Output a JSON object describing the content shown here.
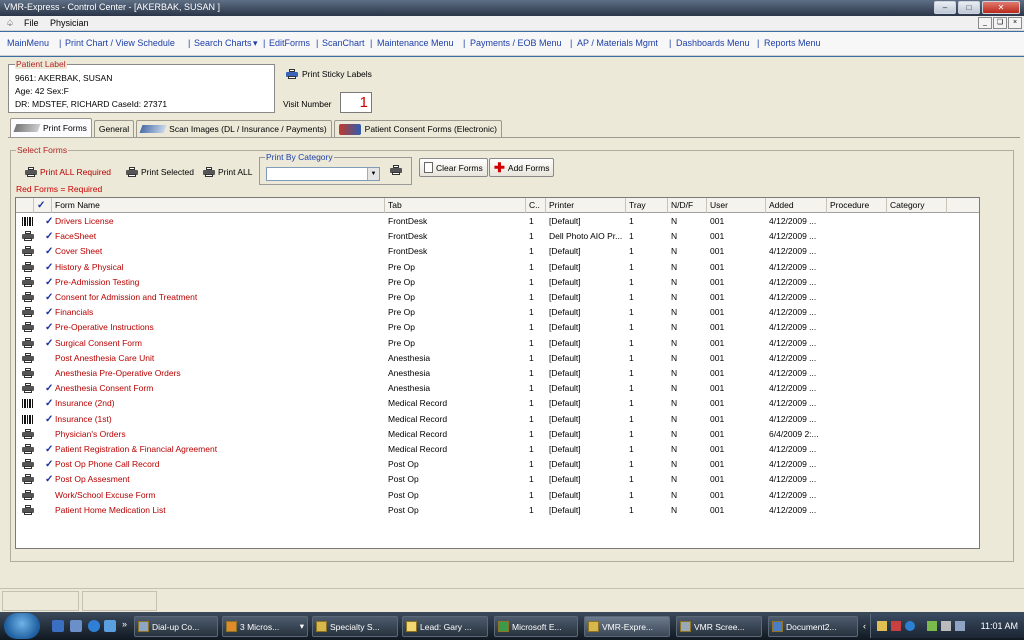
{
  "window": {
    "title": "VMR-Express - Control Center - [AKERBAK, SUSAN     ]"
  },
  "menubar": {
    "file": "File",
    "physician": "Physician"
  },
  "nav": [
    "MainMenu",
    "Print Chart / View Schedule",
    "Search Charts",
    "EditForms",
    "ScanChart",
    "Maintenance Menu",
    "Payments / EOB Menu",
    "AP / Materials Mgmt",
    "Dashboards Menu",
    "Reports Menu"
  ],
  "patient": {
    "legend": "Patient Label",
    "line1": "9661: AKERBAK, SUSAN",
    "line2": "Age: 42    Sex:F",
    "line3": "DR: MDSTEF, RICHARD    CaseId: 27371"
  },
  "sticky_label": "Print Sticky Labels",
  "visit": {
    "label": "Visit Number",
    "value": "1"
  },
  "tabs": [
    "Print Forms",
    "General",
    "Scan Images (DL / Insurance / Payments)",
    "Patient Consent Forms (Electronic)"
  ],
  "select_forms": {
    "legend": "Select Forms",
    "print_all_required": "Print ALL Required",
    "print_selected": "Print Selected",
    "print_all": "Print ALL",
    "category_legend": "Print By Category",
    "category_value": "",
    "clear_forms": "Clear Forms",
    "add_forms": "Add Forms",
    "required_note": "Red Forms = Required"
  },
  "grid": {
    "headers": [
      "",
      "",
      "Form Name",
      "Tab",
      "C..",
      "Printer",
      "Tray",
      "N/D/F",
      "User",
      "Added",
      "Procedure",
      "Category"
    ],
    "rows": [
      {
        "icon": "barcode",
        "checked": true,
        "name": "Drivers License",
        "tab": "FrontDesk",
        "c": "1",
        "printer": "[Default]",
        "tray": "1",
        "ndf": "N",
        "user": "001",
        "added": "4/12/2009 ...",
        "procedure": "",
        "category": ""
      },
      {
        "icon": "printer",
        "checked": true,
        "name": "FaceSheet",
        "tab": "FrontDesk",
        "c": "1",
        "printer": "Dell Photo AIO Pr...",
        "tray": "1",
        "ndf": "N",
        "user": "001",
        "added": "4/12/2009 ...",
        "procedure": "",
        "category": ""
      },
      {
        "icon": "printer",
        "checked": true,
        "name": "Cover Sheet",
        "tab": "FrontDesk",
        "c": "1",
        "printer": "[Default]",
        "tray": "1",
        "ndf": "N",
        "user": "001",
        "added": "4/12/2009 ...",
        "procedure": "",
        "category": ""
      },
      {
        "icon": "printer",
        "checked": true,
        "name": "History & Physical",
        "tab": "Pre Op",
        "c": "1",
        "printer": "[Default]",
        "tray": "1",
        "ndf": "N",
        "user": "001",
        "added": "4/12/2009 ...",
        "procedure": "",
        "category": ""
      },
      {
        "icon": "printer",
        "checked": true,
        "name": "Pre-Admission Testing",
        "tab": "Pre Op",
        "c": "1",
        "printer": "[Default]",
        "tray": "1",
        "ndf": "N",
        "user": "001",
        "added": "4/12/2009 ...",
        "procedure": "",
        "category": ""
      },
      {
        "icon": "printer",
        "checked": true,
        "name": "Consent for Admission and Treatment",
        "tab": "Pre Op",
        "c": "1",
        "printer": "[Default]",
        "tray": "1",
        "ndf": "N",
        "user": "001",
        "added": "4/12/2009 ...",
        "procedure": "",
        "category": ""
      },
      {
        "icon": "printer",
        "checked": true,
        "name": "Financials",
        "tab": "Pre Op",
        "c": "1",
        "printer": "[Default]",
        "tray": "1",
        "ndf": "N",
        "user": "001",
        "added": "4/12/2009 ...",
        "procedure": "",
        "category": ""
      },
      {
        "icon": "printer",
        "checked": true,
        "name": "Pre-Operative Instructions",
        "tab": "Pre Op",
        "c": "1",
        "printer": "[Default]",
        "tray": "1",
        "ndf": "N",
        "user": "001",
        "added": "4/12/2009 ...",
        "procedure": "",
        "category": ""
      },
      {
        "icon": "printer",
        "checked": true,
        "name": "Surgical Consent Form",
        "tab": "Pre Op",
        "c": "1",
        "printer": "[Default]",
        "tray": "1",
        "ndf": "N",
        "user": "001",
        "added": "4/12/2009 ...",
        "procedure": "",
        "category": ""
      },
      {
        "icon": "printer",
        "checked": false,
        "name": "Post Anesthesia Care Unit",
        "tab": "Anesthesia",
        "c": "1",
        "printer": "[Default]",
        "tray": "1",
        "ndf": "N",
        "user": "001",
        "added": "4/12/2009 ...",
        "procedure": "",
        "category": ""
      },
      {
        "icon": "printer",
        "checked": false,
        "name": "Anesthesia Pre-Operative Orders",
        "tab": "Anesthesia",
        "c": "1",
        "printer": "[Default]",
        "tray": "1",
        "ndf": "N",
        "user": "001",
        "added": "4/12/2009 ...",
        "procedure": "",
        "category": ""
      },
      {
        "icon": "printer",
        "checked": true,
        "name": "Anesthesia Consent Form",
        "tab": "Anesthesia",
        "c": "1",
        "printer": "[Default]",
        "tray": "1",
        "ndf": "N",
        "user": "001",
        "added": "4/12/2009 ...",
        "procedure": "",
        "category": ""
      },
      {
        "icon": "barcode",
        "checked": true,
        "name": "Insurance (2nd)",
        "tab": "Medical Record",
        "c": "1",
        "printer": "[Default]",
        "tray": "1",
        "ndf": "N",
        "user": "001",
        "added": "4/12/2009 ...",
        "procedure": "",
        "category": ""
      },
      {
        "icon": "barcode",
        "checked": true,
        "name": "Insurance (1st)",
        "tab": "Medical Record",
        "c": "1",
        "printer": "[Default]",
        "tray": "1",
        "ndf": "N",
        "user": "001",
        "added": "4/12/2009 ...",
        "procedure": "",
        "category": ""
      },
      {
        "icon": "printer",
        "checked": false,
        "name": "Physician's Orders",
        "tab": "Medical Record",
        "c": "1",
        "printer": "[Default]",
        "tray": "1",
        "ndf": "N",
        "user": "001",
        "added": "6/4/2009 2:...",
        "procedure": "",
        "category": ""
      },
      {
        "icon": "printer",
        "checked": true,
        "name": "Patient Registration & Financial Agreement",
        "tab": "Medical Record",
        "c": "1",
        "printer": "[Default]",
        "tray": "1",
        "ndf": "N",
        "user": "001",
        "added": "4/12/2009 ...",
        "procedure": "",
        "category": ""
      },
      {
        "icon": "printer",
        "checked": true,
        "name": "Post Op Phone Call Record",
        "tab": "Post Op",
        "c": "1",
        "printer": "[Default]",
        "tray": "1",
        "ndf": "N",
        "user": "001",
        "added": "4/12/2009 ...",
        "procedure": "",
        "category": ""
      },
      {
        "icon": "printer",
        "checked": true,
        "name": "Post Op Assesment",
        "tab": "Post Op",
        "c": "1",
        "printer": "[Default]",
        "tray": "1",
        "ndf": "N",
        "user": "001",
        "added": "4/12/2009 ...",
        "procedure": "",
        "category": ""
      },
      {
        "icon": "printer",
        "checked": false,
        "name": "Work/School Excuse Form",
        "tab": "Post Op",
        "c": "1",
        "printer": "[Default]",
        "tray": "1",
        "ndf": "N",
        "user": "001",
        "added": "4/12/2009 ...",
        "procedure": "",
        "category": ""
      },
      {
        "icon": "printer",
        "checked": false,
        "name": "Patient Home Medication List",
        "tab": "Post Op",
        "c": "1",
        "printer": "[Default]",
        "tray": "1",
        "ndf": "N",
        "user": "001",
        "added": "4/12/2009 ...",
        "procedure": "",
        "category": ""
      }
    ]
  },
  "taskbar": {
    "items": [
      "Dial-up Co...",
      "3 Micros...",
      "Specialty S...",
      "Lead: Gary ...",
      "Microsoft E...",
      "VMR-Expre...",
      "VMR Scree...",
      "Document2..."
    ],
    "clock": "11:01 AM"
  },
  "colors": {
    "required_form": "#b80000",
    "nav_link": "#1c3fa8",
    "visit_number": "#cc0000"
  }
}
